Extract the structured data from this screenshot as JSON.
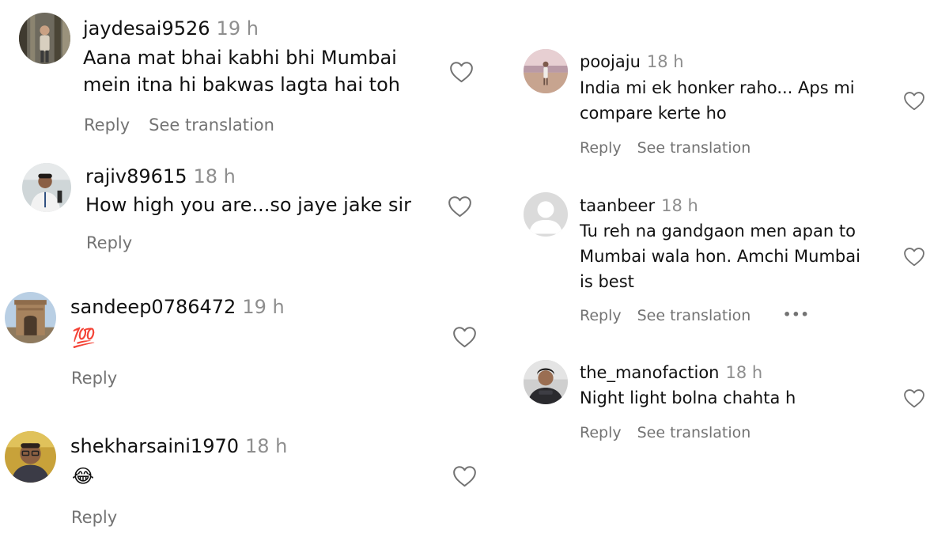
{
  "comments_left": [
    {
      "username": "jaydesai9526",
      "time": "19 h",
      "lines": [
        "Aana mat bhai kabhi bhi Mumbai",
        "mein itna hi bakwas lagta hai toh"
      ],
      "reply": "Reply",
      "translate": "See translation"
    },
    {
      "username": "rajiv89615",
      "time": "18 h",
      "lines": [
        "How high you are...so jaye jake sir"
      ],
      "reply": "Reply"
    },
    {
      "username": "sandeep0786472",
      "time": "19 h",
      "lines": [
        "💯"
      ],
      "reply": "Reply"
    },
    {
      "username": "shekharsaini1970",
      "time": "18 h",
      "lines": [
        "😂"
      ],
      "reply": "Reply"
    }
  ],
  "comments_right": [
    {
      "username": "poojaju",
      "time": "18 h",
      "lines": [
        "India mi ek honker raho... Aps mi",
        "compare kerte ho"
      ],
      "reply": "Reply",
      "translate": "See translation"
    },
    {
      "username": "taanbeer",
      "time": "18 h",
      "lines": [
        "Tu reh na gandgaon men apan to",
        "Mumbai wala hon. Amchi Mumbai",
        "is best"
      ],
      "reply": "Reply",
      "translate": "See translation",
      "more": "•••"
    },
    {
      "username": "the_manofaction",
      "time": "18 h",
      "lines": [
        "Night light bolna chahta h"
      ],
      "reply": "Reply",
      "translate": "See translation"
    }
  ]
}
